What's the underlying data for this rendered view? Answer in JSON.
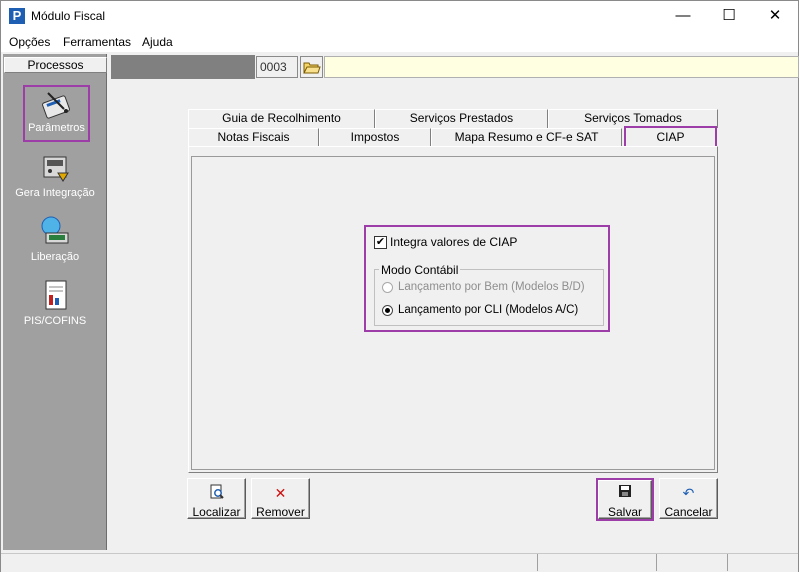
{
  "window": {
    "title": "Módulo Fiscal",
    "app_icon_letter": "P",
    "minimize": "—",
    "maximize": "☐",
    "close": "✕"
  },
  "menu": {
    "items": [
      "Opções",
      "Ferramentas",
      "Ajuda"
    ]
  },
  "sidebar": {
    "header": "Processos",
    "items": [
      {
        "label": "Parâmetros",
        "icon": "parameters-icon"
      },
      {
        "label": "Gera Integração",
        "icon": "integration-icon"
      },
      {
        "label": "Liberação",
        "icon": "release-icon"
      },
      {
        "label": "PIS/COFINS",
        "icon": "pis-cofins-icon"
      }
    ]
  },
  "toolbar": {
    "code_value": "0003"
  },
  "tabs": {
    "row1": [
      "Guia de Recolhimento",
      "Serviços Prestados",
      "Serviços Tomados"
    ],
    "row2": [
      "Notas Fiscais",
      "Impostos",
      "Mapa Resumo e CF-e SAT",
      "CIAP"
    ],
    "active": "CIAP"
  },
  "ciap": {
    "integra_label": "Integra valores de CIAP",
    "integra_checked": true,
    "modo_contabil_legend": "Modo Contábil",
    "radio_bem_label": "Lançamento por Bem (Modelos B/D)",
    "radio_bem_enabled": false,
    "radio_cli_label": "Lançamento por CLI (Modelos A/C)",
    "radio_cli_selected": true
  },
  "buttons": {
    "localizar": "Localizar",
    "remover": "Remover",
    "salvar": "Salvar",
    "cancelar": "Cancelar"
  },
  "colors": {
    "highlight": "#9d3ea8",
    "sidebar_bg": "#a0a0a0",
    "yellow_strip": "#ffffe1"
  }
}
